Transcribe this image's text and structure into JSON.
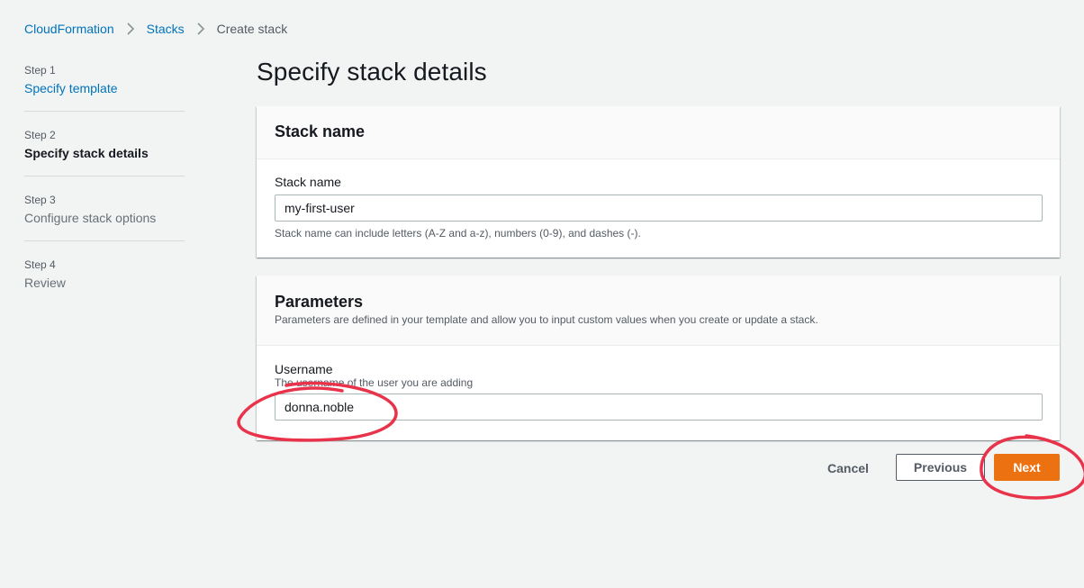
{
  "breadcrumb": {
    "items": [
      "CloudFormation",
      "Stacks",
      "Create stack"
    ]
  },
  "steps": [
    {
      "num": "Step 1",
      "label": "Specify template"
    },
    {
      "num": "Step 2",
      "label": "Specify stack details"
    },
    {
      "num": "Step 3",
      "label": "Configure stack options"
    },
    {
      "num": "Step 4",
      "label": "Review"
    }
  ],
  "main": {
    "title": "Specify stack details",
    "stack_name_panel": {
      "header": "Stack name",
      "field_label": "Stack name",
      "value": "my-first-user",
      "hint": "Stack name can include letters (A-Z and a-z), numbers (0-9), and dashes (-)."
    },
    "parameters_panel": {
      "header": "Parameters",
      "description": "Parameters are defined in your template and allow you to input custom values when you create or update a stack.",
      "field_label": "Username",
      "field_description": "The username of the user you are adding",
      "value": "donna.noble"
    }
  },
  "actions": {
    "cancel": "Cancel",
    "previous": "Previous",
    "next": "Next"
  },
  "colors": {
    "link": "#0073bb",
    "primary_button": "#ec7211",
    "annotation": "#e8334a"
  },
  "icons": {
    "breadcrumb_separator": "chevron-right-icon"
  }
}
